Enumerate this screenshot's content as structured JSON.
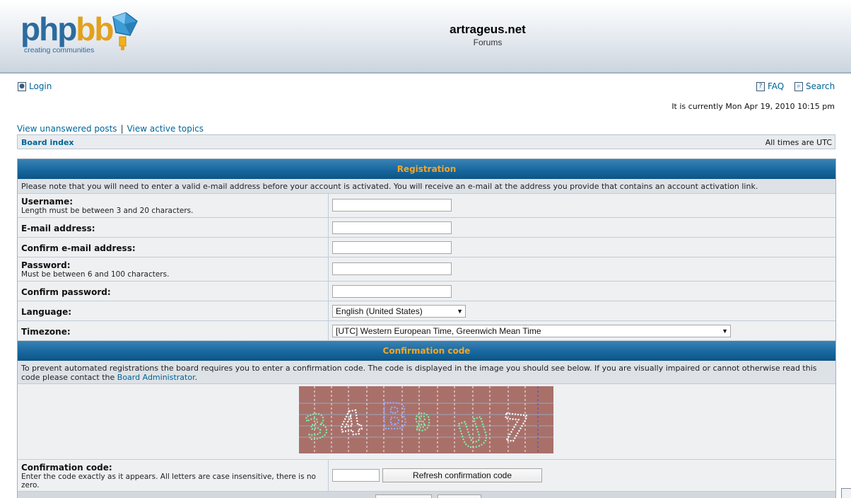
{
  "site": {
    "title": "artrageus.net",
    "description": "Forums"
  },
  "logo": {
    "word_main": "php",
    "word_accent": "bb",
    "tagline": "creating communities"
  },
  "nav": {
    "login": "Login",
    "faq": "FAQ",
    "search": "Search",
    "current_time": "It is currently Mon Apr 19, 2010 10:15 pm",
    "view_unanswered": "View unanswered posts",
    "separator": "|",
    "view_active": "View active topics"
  },
  "breadcrumb": {
    "board_index": "Board index",
    "timezone_note": "All times are UTC"
  },
  "registration": {
    "header": "Registration",
    "notice": "Please note that you will need to enter a valid e-mail address before your account is activated. You will receive an e-mail at the address you provide that contains an account activation link.",
    "fields": [
      {
        "label": "Username:",
        "help": "Length must be between 3 and 20 characters.",
        "value": ""
      },
      {
        "label": "E-mail address:",
        "help": "",
        "value": ""
      },
      {
        "label": "Confirm e-mail address:",
        "help": "",
        "value": ""
      },
      {
        "label": "Password:",
        "help": "Must be between 6 and 100 characters.",
        "value": ""
      },
      {
        "label": "Confirm password:",
        "help": "",
        "value": ""
      }
    ],
    "language": {
      "label": "Language:",
      "selected": "English (United States)"
    },
    "timezone": {
      "label": "Timezone:",
      "selected": "[UTC] Western European Time, Greenwich Mean Time"
    }
  },
  "confirmation": {
    "header": "Confirmation code",
    "notice_text": "To prevent automated registrations the board requires you to enter a confirmation code. The code is displayed in the image you should see below. If you are visually impaired or cannot otherwise read this code please contact the ",
    "notice_link": "Board Administrator",
    "notice_end": ".",
    "captcha_glyphs": [
      "3",
      "4",
      "B",
      "9",
      "U",
      "7"
    ],
    "code_label": "Confirmation code:",
    "code_help": "Enter the code exactly as it appears. All letters are case insensitive, there is no zero.",
    "code_value": "",
    "refresh_button": "Refresh confirmation code"
  },
  "colors": {
    "header_bar": "#18689f",
    "header_text": "#f3a625",
    "link": "#006597",
    "captcha_bg": "#a9706a"
  }
}
